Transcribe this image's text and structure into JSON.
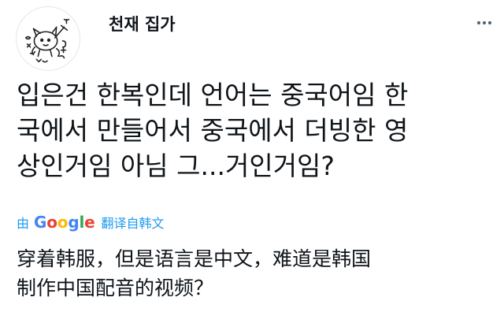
{
  "author": {
    "name": "천재 집가"
  },
  "avatar": {
    "label": "avatar-drawing"
  },
  "more_menu": {
    "icon": "more-dots-icon"
  },
  "tweet": {
    "lines": [
      "입은건 한복인데 언어는 중국어임 한",
      "국에서 만들어서 중국에서 더빙한 영",
      "상인거임 아님 그...거인거임?"
    ]
  },
  "translation": {
    "by": "由",
    "google": [
      "G",
      "o",
      "o",
      "g",
      "l",
      "e"
    ],
    "google_colors": [
      "#4285f4",
      "#ea4335",
      "#fbbc05",
      "#4285f4",
      "#34a853",
      "#ea4335"
    ],
    "source_label": "翻译自韩文",
    "lines": [
      "穿着韩服，但是语言是中文，难道是韩国",
      "制作中国配音的视频？"
    ]
  },
  "colors": {
    "link": "#1d9bf0",
    "text": "#0f1419"
  }
}
